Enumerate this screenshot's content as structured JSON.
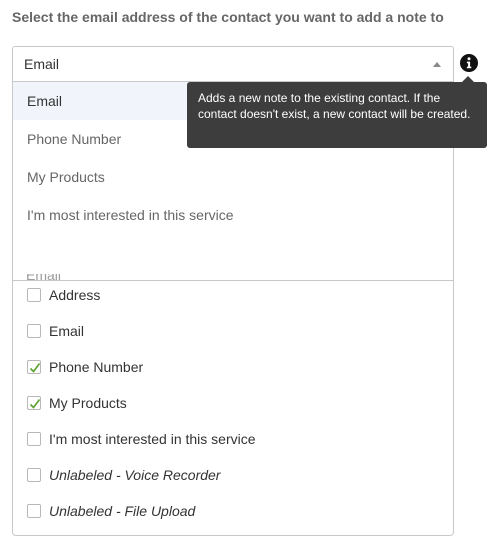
{
  "prompt": "Select the email address of the contact you want to add a note to",
  "select": {
    "value": "Email"
  },
  "info_icon": "info-icon",
  "tooltip": {
    "text": "Adds a new note to the existing contact. If the contact doesn't exist, a new contact will be created."
  },
  "dropdown": {
    "options": [
      {
        "label": "Email",
        "selected": true
      },
      {
        "label": "Phone Number",
        "selected": false
      },
      {
        "label": "My Products",
        "selected": false
      },
      {
        "label": "I'm most interested in this service",
        "selected": false
      }
    ],
    "partial_text": "Email"
  },
  "fields": [
    {
      "label": "Address",
      "checked": false,
      "italic": false
    },
    {
      "label": "Email",
      "checked": false,
      "italic": false
    },
    {
      "label": "Phone Number",
      "checked": true,
      "italic": false
    },
    {
      "label": "My Products",
      "checked": true,
      "italic": false
    },
    {
      "label": "I'm most interested in this service",
      "checked": false,
      "italic": false
    },
    {
      "label": "Unlabeled - Voice Recorder",
      "checked": false,
      "italic": true
    },
    {
      "label": "Unlabeled - File Upload",
      "checked": false,
      "italic": true
    }
  ],
  "colors": {
    "check": "#5aa02c",
    "tooltip_bg": "#3d3d3d",
    "selected_bg": "#f1f5fb"
  }
}
